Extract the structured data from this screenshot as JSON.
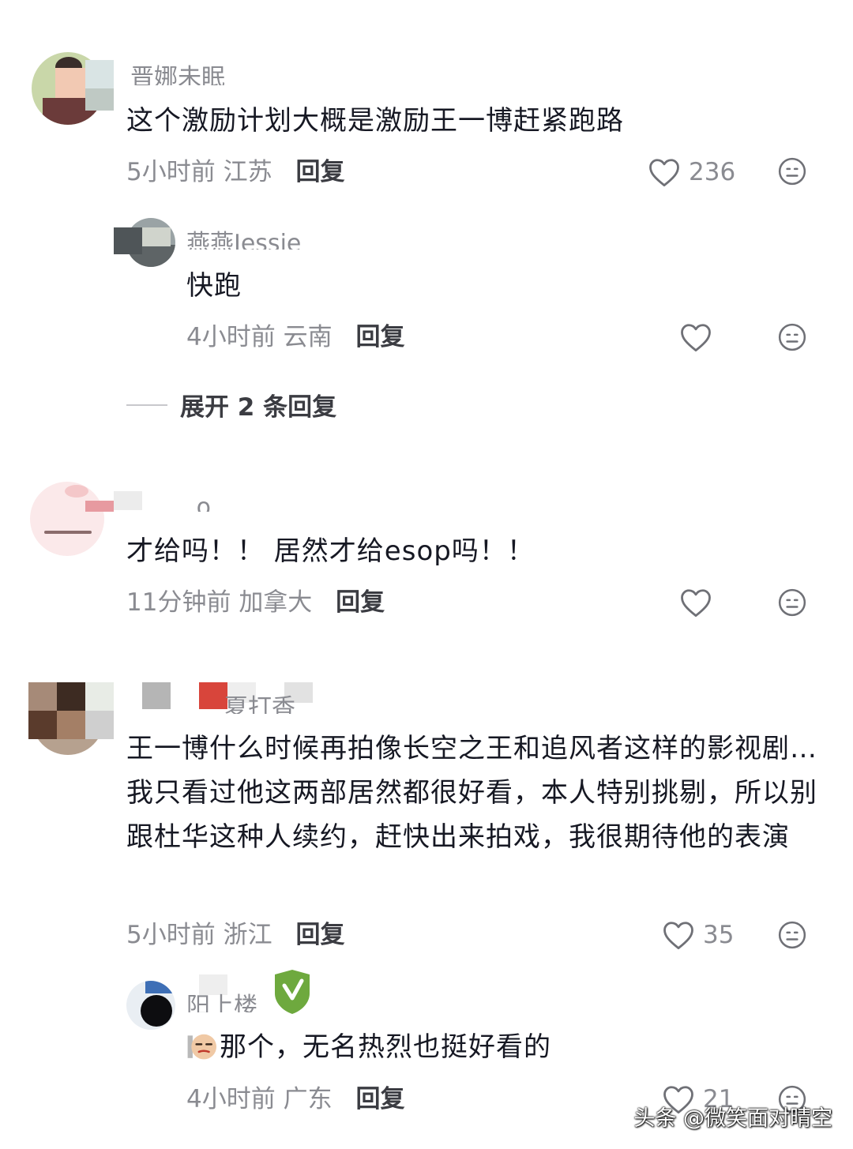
{
  "comments": [
    {
      "author": "晋娜未眠",
      "text": "这个激励计划大概是激励王一博赶紧跑路",
      "time": "5小时前",
      "location": "江苏",
      "reply_label": "回复",
      "likes": "236",
      "replies": [
        {
          "author": "燕燕Jessie",
          "text": "快跑",
          "time": "4小时前",
          "location": "云南",
          "reply_label": "回复",
          "likes": ""
        }
      ],
      "expand_label": "展开 2 条回复"
    },
    {
      "author": "...o",
      "text": "才给吗！！ 居然才给esop吗！！",
      "time": "11分钟前",
      "location": "加拿大",
      "reply_label": "回复",
      "likes": ""
    },
    {
      "author": "夏打香",
      "text": "王一博什么时候再拍像长空之王和追风者这样的影视剧…我只看过他这两部居然都很好看，本人特别挑剔，所以别跟杜华这种人续约，赶快出来拍戏，我很期待他的表演",
      "time": "5小时前",
      "location": "浙江",
      "reply_label": "回复",
      "likes": "35",
      "replies": [
        {
          "author": "阳上楼",
          "text": "那个，无名热烈也挺好看的",
          "emoji_icon": "smirk-face-emoji-icon",
          "time": "4小时前",
          "location": "广东",
          "reply_label": "回复",
          "likes": "21"
        }
      ]
    }
  ],
  "watermark": "头条 @微笑面对晴空",
  "icons": {
    "like": "heart-outline-icon",
    "dislike": "neutral-face-icon"
  },
  "colors": {
    "text": "#161823",
    "meta": "#8a8b91",
    "reply": "#3b3c42",
    "background": "#ffffff"
  }
}
